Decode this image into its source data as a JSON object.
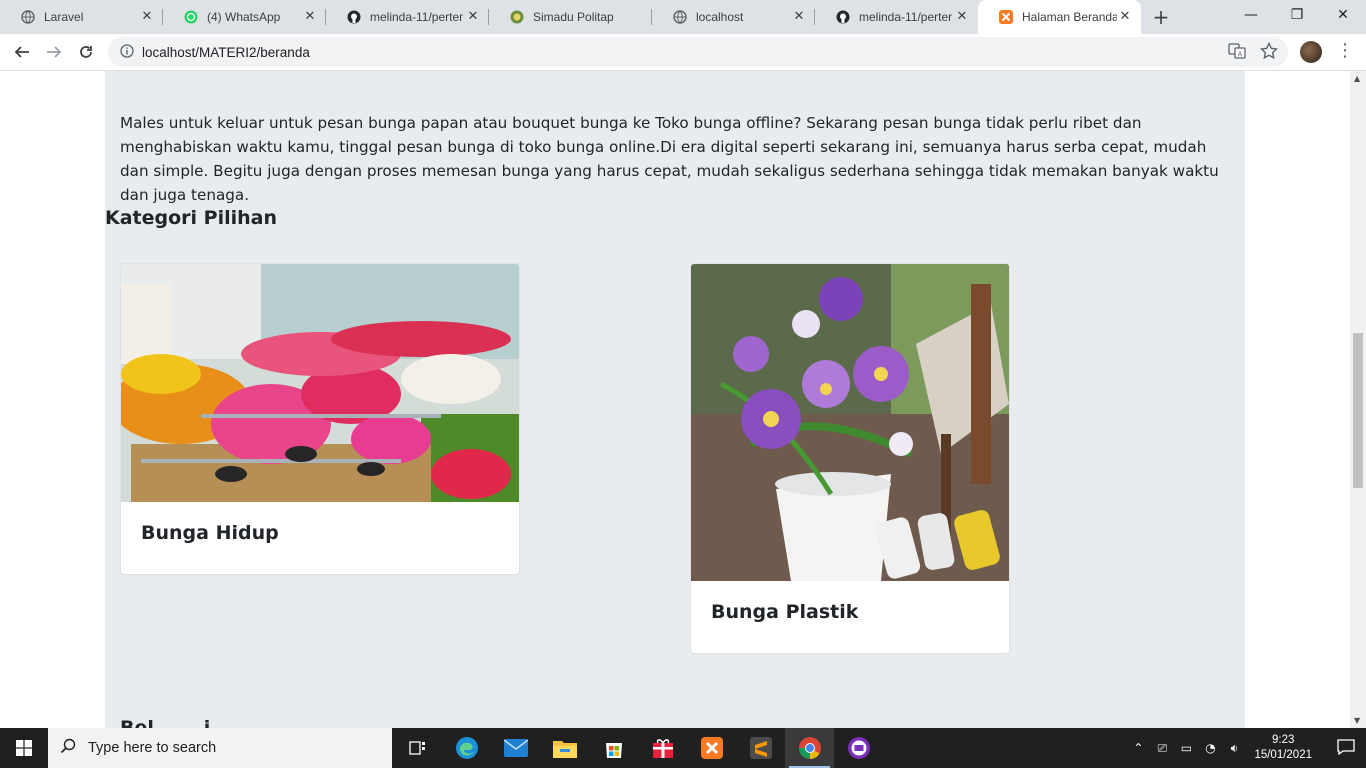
{
  "browser": {
    "tabs": [
      {
        "title": "Laravel",
        "icon": "globe-icon"
      },
      {
        "title": "(4) WhatsApp",
        "icon": "whatsapp-icon"
      },
      {
        "title": "melinda-11/perter",
        "icon": "github-icon"
      },
      {
        "title": "Simadu Politap",
        "icon": "simadu-icon"
      },
      {
        "title": "localhost",
        "icon": "globe-icon"
      },
      {
        "title": "melinda-11/perter",
        "icon": "github-icon"
      },
      {
        "title": "Halaman Beranda",
        "icon": "xampp-icon",
        "active": true
      }
    ],
    "new_tab": "+",
    "url": "localhost/MATERI2/beranda"
  },
  "page": {
    "intro": "Males untuk keluar untuk pesan bunga papan atau bouquet bunga ke Toko bunga offline? Sekarang pesan bunga tidak perlu ribet dan menghabiskan waktu kamu, tinggal pesan bunga di toko bunga online.Di era digital seperti sekarang ini, semuanya harus serba cepat, mudah dan simple. Begitu juga dengan proses memesan bunga yang harus cepat, mudah sekaligus sederhana sehingga tidak memakan banyak waktu dan juga tenaga.",
    "category_title": "Kategori Pilihan",
    "cards": [
      {
        "label": "Bunga Hidup"
      },
      {
        "label": "Bunga Plastik"
      }
    ],
    "next_section": "Bel... ...i..."
  },
  "taskbar": {
    "search_placeholder": "Type here to search",
    "time": "9:23",
    "date": "15/01/2021"
  },
  "colors": {
    "content_bg": "#e9ecef",
    "taskbar_bg": "#202020",
    "tabstrip_bg": "#dee1e6"
  }
}
